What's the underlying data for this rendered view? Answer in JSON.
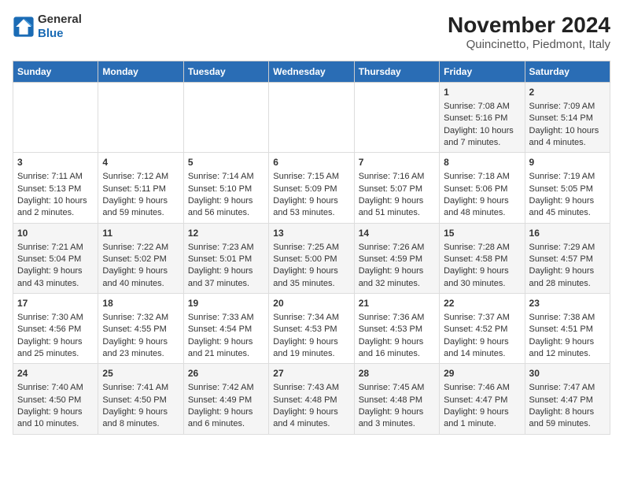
{
  "header": {
    "logo_line1": "General",
    "logo_line2": "Blue",
    "title": "November 2024",
    "subtitle": "Quincinetto, Piedmont, Italy"
  },
  "days_of_week": [
    "Sunday",
    "Monday",
    "Tuesday",
    "Wednesday",
    "Thursday",
    "Friday",
    "Saturday"
  ],
  "weeks": [
    [
      {
        "day": "",
        "info": ""
      },
      {
        "day": "",
        "info": ""
      },
      {
        "day": "",
        "info": ""
      },
      {
        "day": "",
        "info": ""
      },
      {
        "day": "",
        "info": ""
      },
      {
        "day": "1",
        "info": "Sunrise: 7:08 AM\nSunset: 5:16 PM\nDaylight: 10 hours and 7 minutes."
      },
      {
        "day": "2",
        "info": "Sunrise: 7:09 AM\nSunset: 5:14 PM\nDaylight: 10 hours and 4 minutes."
      }
    ],
    [
      {
        "day": "3",
        "info": "Sunrise: 7:11 AM\nSunset: 5:13 PM\nDaylight: 10 hours and 2 minutes."
      },
      {
        "day": "4",
        "info": "Sunrise: 7:12 AM\nSunset: 5:11 PM\nDaylight: 9 hours and 59 minutes."
      },
      {
        "day": "5",
        "info": "Sunrise: 7:14 AM\nSunset: 5:10 PM\nDaylight: 9 hours and 56 minutes."
      },
      {
        "day": "6",
        "info": "Sunrise: 7:15 AM\nSunset: 5:09 PM\nDaylight: 9 hours and 53 minutes."
      },
      {
        "day": "7",
        "info": "Sunrise: 7:16 AM\nSunset: 5:07 PM\nDaylight: 9 hours and 51 minutes."
      },
      {
        "day": "8",
        "info": "Sunrise: 7:18 AM\nSunset: 5:06 PM\nDaylight: 9 hours and 48 minutes."
      },
      {
        "day": "9",
        "info": "Sunrise: 7:19 AM\nSunset: 5:05 PM\nDaylight: 9 hours and 45 minutes."
      }
    ],
    [
      {
        "day": "10",
        "info": "Sunrise: 7:21 AM\nSunset: 5:04 PM\nDaylight: 9 hours and 43 minutes."
      },
      {
        "day": "11",
        "info": "Sunrise: 7:22 AM\nSunset: 5:02 PM\nDaylight: 9 hours and 40 minutes."
      },
      {
        "day": "12",
        "info": "Sunrise: 7:23 AM\nSunset: 5:01 PM\nDaylight: 9 hours and 37 minutes."
      },
      {
        "day": "13",
        "info": "Sunrise: 7:25 AM\nSunset: 5:00 PM\nDaylight: 9 hours and 35 minutes."
      },
      {
        "day": "14",
        "info": "Sunrise: 7:26 AM\nSunset: 4:59 PM\nDaylight: 9 hours and 32 minutes."
      },
      {
        "day": "15",
        "info": "Sunrise: 7:28 AM\nSunset: 4:58 PM\nDaylight: 9 hours and 30 minutes."
      },
      {
        "day": "16",
        "info": "Sunrise: 7:29 AM\nSunset: 4:57 PM\nDaylight: 9 hours and 28 minutes."
      }
    ],
    [
      {
        "day": "17",
        "info": "Sunrise: 7:30 AM\nSunset: 4:56 PM\nDaylight: 9 hours and 25 minutes."
      },
      {
        "day": "18",
        "info": "Sunrise: 7:32 AM\nSunset: 4:55 PM\nDaylight: 9 hours and 23 minutes."
      },
      {
        "day": "19",
        "info": "Sunrise: 7:33 AM\nSunset: 4:54 PM\nDaylight: 9 hours and 21 minutes."
      },
      {
        "day": "20",
        "info": "Sunrise: 7:34 AM\nSunset: 4:53 PM\nDaylight: 9 hours and 19 minutes."
      },
      {
        "day": "21",
        "info": "Sunrise: 7:36 AM\nSunset: 4:53 PM\nDaylight: 9 hours and 16 minutes."
      },
      {
        "day": "22",
        "info": "Sunrise: 7:37 AM\nSunset: 4:52 PM\nDaylight: 9 hours and 14 minutes."
      },
      {
        "day": "23",
        "info": "Sunrise: 7:38 AM\nSunset: 4:51 PM\nDaylight: 9 hours and 12 minutes."
      }
    ],
    [
      {
        "day": "24",
        "info": "Sunrise: 7:40 AM\nSunset: 4:50 PM\nDaylight: 9 hours and 10 minutes."
      },
      {
        "day": "25",
        "info": "Sunrise: 7:41 AM\nSunset: 4:50 PM\nDaylight: 9 hours and 8 minutes."
      },
      {
        "day": "26",
        "info": "Sunrise: 7:42 AM\nSunset: 4:49 PM\nDaylight: 9 hours and 6 minutes."
      },
      {
        "day": "27",
        "info": "Sunrise: 7:43 AM\nSunset: 4:48 PM\nDaylight: 9 hours and 4 minutes."
      },
      {
        "day": "28",
        "info": "Sunrise: 7:45 AM\nSunset: 4:48 PM\nDaylight: 9 hours and 3 minutes."
      },
      {
        "day": "29",
        "info": "Sunrise: 7:46 AM\nSunset: 4:47 PM\nDaylight: 9 hours and 1 minute."
      },
      {
        "day": "30",
        "info": "Sunrise: 7:47 AM\nSunset: 4:47 PM\nDaylight: 8 hours and 59 minutes."
      }
    ]
  ]
}
